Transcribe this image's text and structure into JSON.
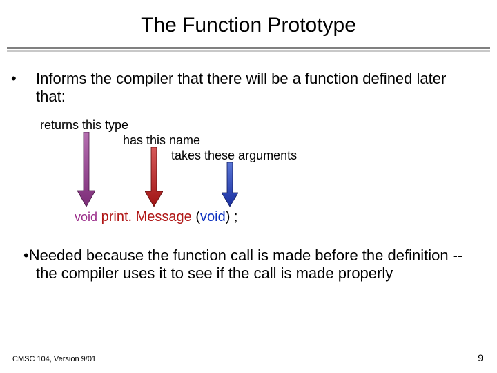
{
  "title": "The Function Prototype",
  "bullet1": "Informs the compiler that there will be a function defined later that:",
  "labels": {
    "returns": "returns this type",
    "hasname": "has this name",
    "takes": "takes these arguments"
  },
  "proto": {
    "void1": "void",
    "name": "print. Message",
    "paren_open": "(",
    "void2": "void",
    "paren_close_semi": ") ;"
  },
  "bullet2": "Needed because the function call is made before the definition -- the compiler uses it to see if the call is made properly",
  "footer_left": "CMSC 104, Version 9/01",
  "footer_right": "9",
  "colors": {
    "arrow_purple_top": "#b56fb0",
    "arrow_purple_bot": "#7c2d78",
    "arrow_red_top": "#d65a5a",
    "arrow_red_bot": "#a01414",
    "arrow_blue_top": "#5a76d6",
    "arrow_blue_bot": "#1a2fa0"
  }
}
